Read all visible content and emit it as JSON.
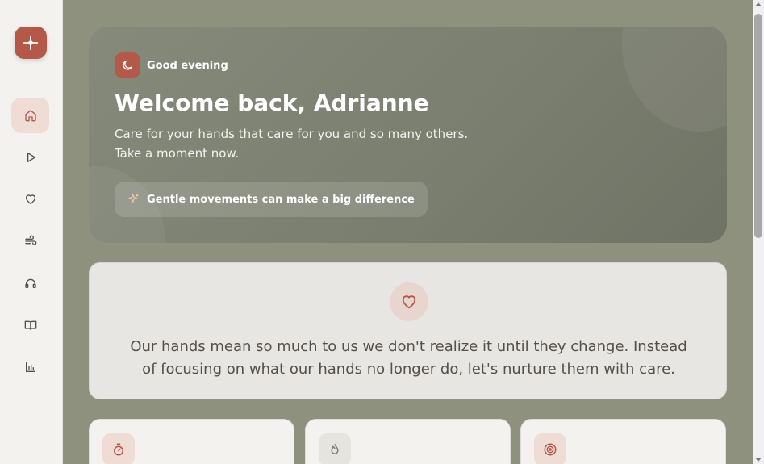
{
  "colors": {
    "accent": "#b4594a",
    "sidebar_bg": "#f4f2ee",
    "main_bg": "#8f917f",
    "active_nav_bg": "#efdcd5"
  },
  "sidebar": {
    "logo_icon": "sparkle-plus-icon",
    "items": [
      {
        "icon": "home-icon",
        "active": true
      },
      {
        "icon": "play-icon",
        "active": false
      },
      {
        "icon": "heart-icon",
        "active": false
      },
      {
        "icon": "wind-icon",
        "active": false
      },
      {
        "icon": "headphones-icon",
        "active": false
      },
      {
        "icon": "book-icon",
        "active": false
      },
      {
        "icon": "bar-chart-icon",
        "active": false
      }
    ]
  },
  "hero": {
    "greeting": "Good evening",
    "greeting_icon": "moon-icon",
    "title": "Welcome back, Adrianne",
    "subtitle": "Care for your hands that care for you and so many others. Take a moment now.",
    "pill_icon": "sparkles-icon",
    "pill_text": "Gentle movements can make a big difference"
  },
  "quote": {
    "icon": "heart-icon",
    "text": "Our hands mean so much to us we don't realize it until they change. Instead of focusing on what our hands no longer do, let's nurture them with care."
  },
  "features": [
    {
      "icon": "timer-icon"
    },
    {
      "icon": "flame-icon"
    },
    {
      "icon": "target-icon"
    }
  ]
}
